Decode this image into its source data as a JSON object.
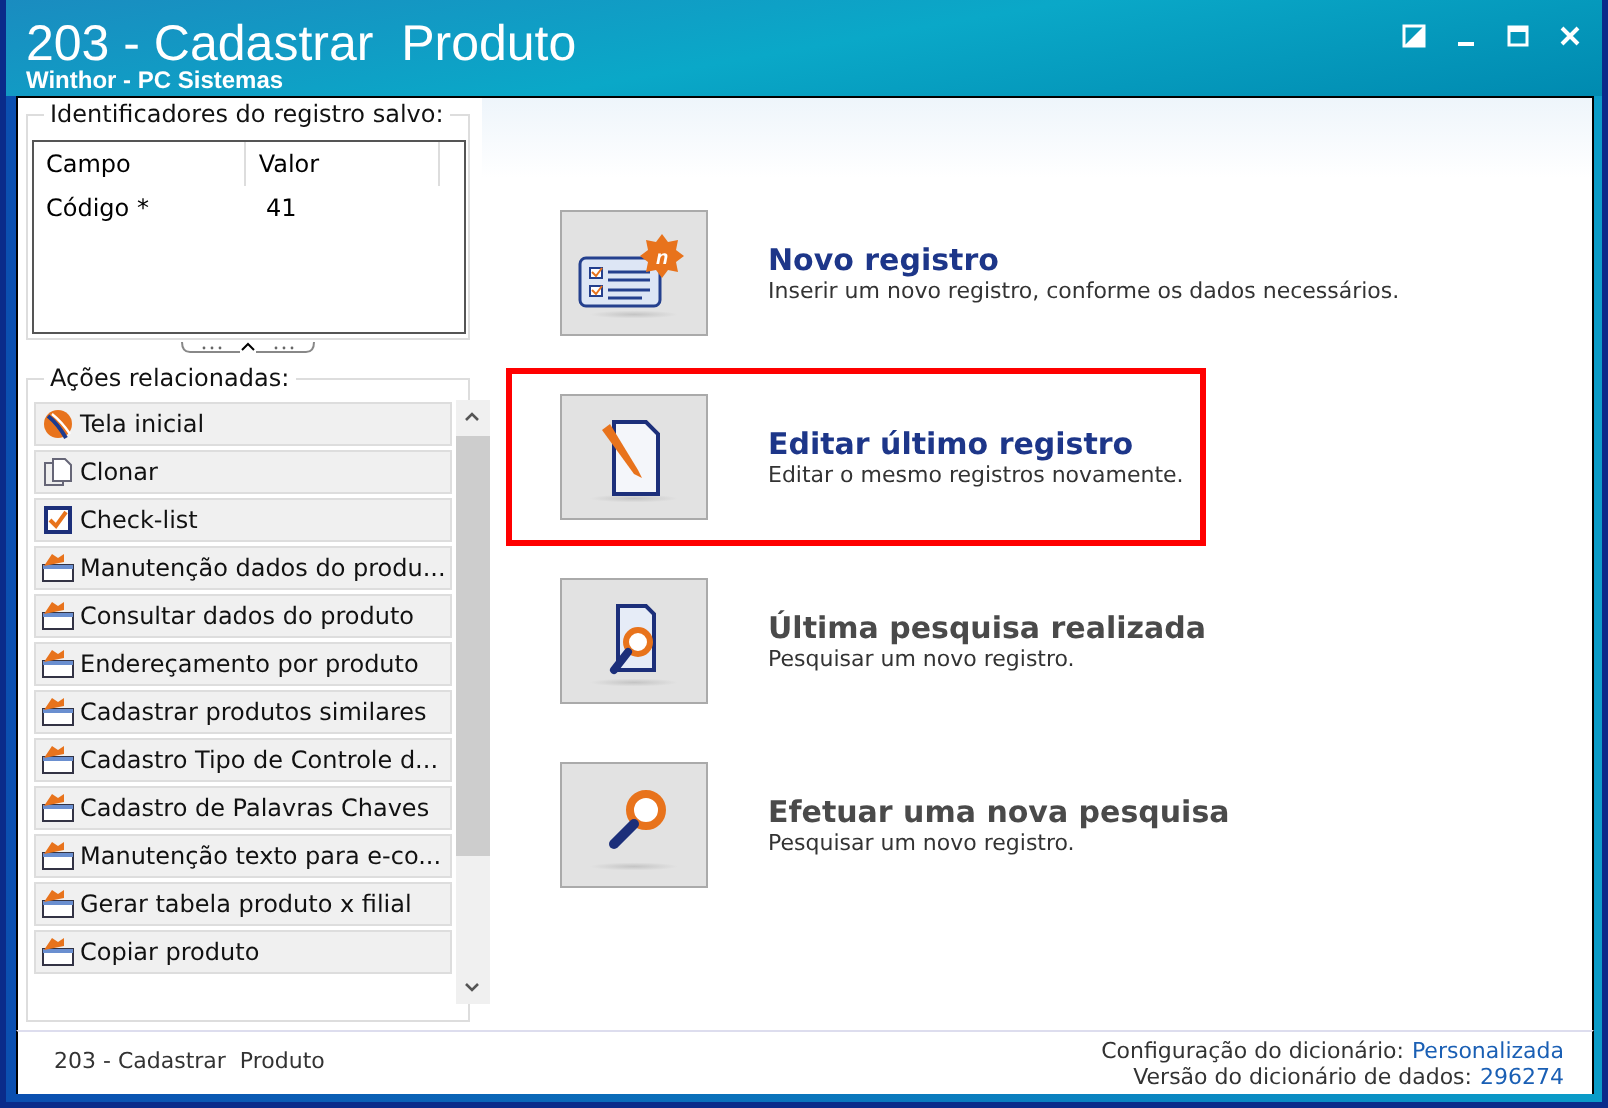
{
  "window": {
    "title": "203 - Cadastrar  Produto",
    "subtitle": "Winthor - PC Sistemas"
  },
  "identifiers": {
    "title": "Identificadores do registro salvo:",
    "columns": [
      "Campo",
      "Valor"
    ],
    "rows": [
      [
        "Código *",
        "41"
      ]
    ]
  },
  "related_actions": {
    "title": "Ações relacionadas:",
    "items": [
      {
        "label": "Tela inicial",
        "kind": "home"
      },
      {
        "label": "Clonar",
        "kind": "clone"
      },
      {
        "label": "Check-list",
        "kind": "check"
      },
      {
        "label": "Manutenção dados do produ...",
        "kind": "window"
      },
      {
        "label": "Consultar dados do produto",
        "kind": "window"
      },
      {
        "label": "Endereçamento por produto",
        "kind": "window"
      },
      {
        "label": "Cadastrar produtos similares",
        "kind": "window"
      },
      {
        "label": "Cadastro Tipo de Controle d...",
        "kind": "window"
      },
      {
        "label": "Cadastro de Palavras Chaves",
        "kind": "window"
      },
      {
        "label": "Manutenção texto para e-co...",
        "kind": "window"
      },
      {
        "label": "Gerar tabela produto x filial",
        "kind": "window"
      },
      {
        "label": "Copiar produto",
        "kind": "window"
      }
    ]
  },
  "actions": [
    {
      "title": "Novo registro",
      "description": "Inserir um novo registro, conforme os dados necessários.",
      "kind": "new",
      "badge": "n",
      "disabled": false,
      "highlighted": false
    },
    {
      "title": "Editar último registro",
      "description": "Editar o mesmo registros novamente.",
      "kind": "edit",
      "disabled": false,
      "highlighted": true
    },
    {
      "title": "Última pesquisa realizada",
      "description": "Pesquisar um novo registro.",
      "kind": "last-search",
      "disabled": true,
      "highlighted": false
    },
    {
      "title": "Efetuar uma nova pesquisa",
      "description": "Pesquisar um novo registro.",
      "kind": "search",
      "disabled": true,
      "highlighted": false
    }
  ],
  "status_bar": {
    "left": "203 - Cadastrar  Produto",
    "dictionary_config_label": "Configuração do dicionário:",
    "dictionary_config_value": "Personalizada",
    "dictionary_version_label": "Versão do dicionário de dados:",
    "dictionary_version_value": "296274"
  }
}
